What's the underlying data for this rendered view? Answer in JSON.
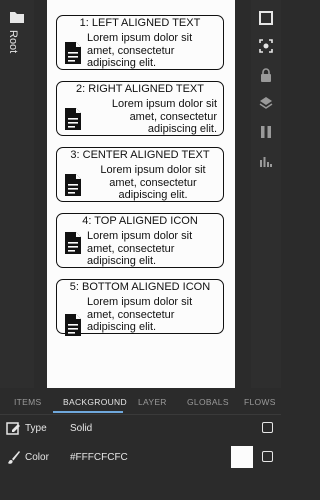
{
  "left_rail": {
    "root_label": "Root",
    "folder_icon": "folder-icon"
  },
  "right_rail": {
    "icons": [
      "stop-icon",
      "focus-icon",
      "lock-icon",
      "layers-icon",
      "pause-icon",
      "bar-chart-icon"
    ]
  },
  "canvas": {
    "cards": [
      {
        "title": "1: LEFT ALIGNED TEXT",
        "line1": "Lorem ipsum dolor sit",
        "line2": "amet, consectetur",
        "line3": "adipiscing elit."
      },
      {
        "title": "2: RIGHT ALIGNED TEXT",
        "line1": "Lorem ipsum dolor sit",
        "line2": "amet, consectetur",
        "line3": "adipiscing elit."
      },
      {
        "title": "3: CENTER ALIGNED TEXT",
        "line1": "Lorem ipsum dolor sit",
        "line2": "amet, consectetur",
        "line3": "adipiscing elit."
      },
      {
        "title": "4: TOP ALIGNED ICON",
        "line1": "Lorem ipsum dolor sit",
        "line2": "amet, consectetur",
        "line3": "adipiscing elit."
      },
      {
        "title": "5: BOTTOM ALIGNED ICON",
        "line1": "Lorem ipsum dolor sit",
        "line2": "amet, consectetur",
        "line3": "adipiscing elit."
      }
    ]
  },
  "tabs": [
    "ITEMS",
    "BACKGROUND",
    "LAYER",
    "GLOBALS",
    "FLOWS"
  ],
  "active_tab": "BACKGROUND",
  "properties": {
    "type": {
      "label": "Type",
      "value": "Solid"
    },
    "color": {
      "label": "Color",
      "value": "#FFFCFCFC"
    }
  },
  "colors": {
    "accent": "#6fa8dc",
    "swatch": "#fcfcfc",
    "background": "#2b2b2b"
  }
}
